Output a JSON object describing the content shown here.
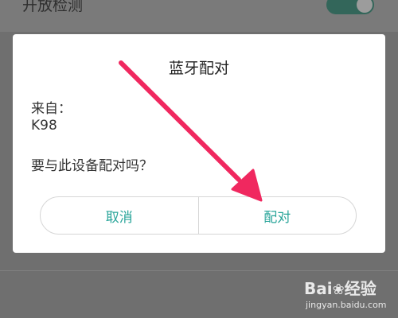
{
  "background": {
    "setting_label": "开放检测",
    "toggle_on": true
  },
  "dialog": {
    "title": "蓝牙配对",
    "from_label": "来自：",
    "device_name": "K98",
    "prompt": "要与此设备配对吗？",
    "cancel_label": "取消",
    "pair_label": "配对"
  },
  "colors": {
    "accent": "#2aa59a",
    "annotation_arrow": "#f0285f",
    "toggle": "#33665a"
  },
  "watermark": {
    "logo_text": "Bai",
    "logo_paw_icon": "paw-icon",
    "logo_suffix": "经验",
    "url": "jingyan.baidu.com"
  }
}
